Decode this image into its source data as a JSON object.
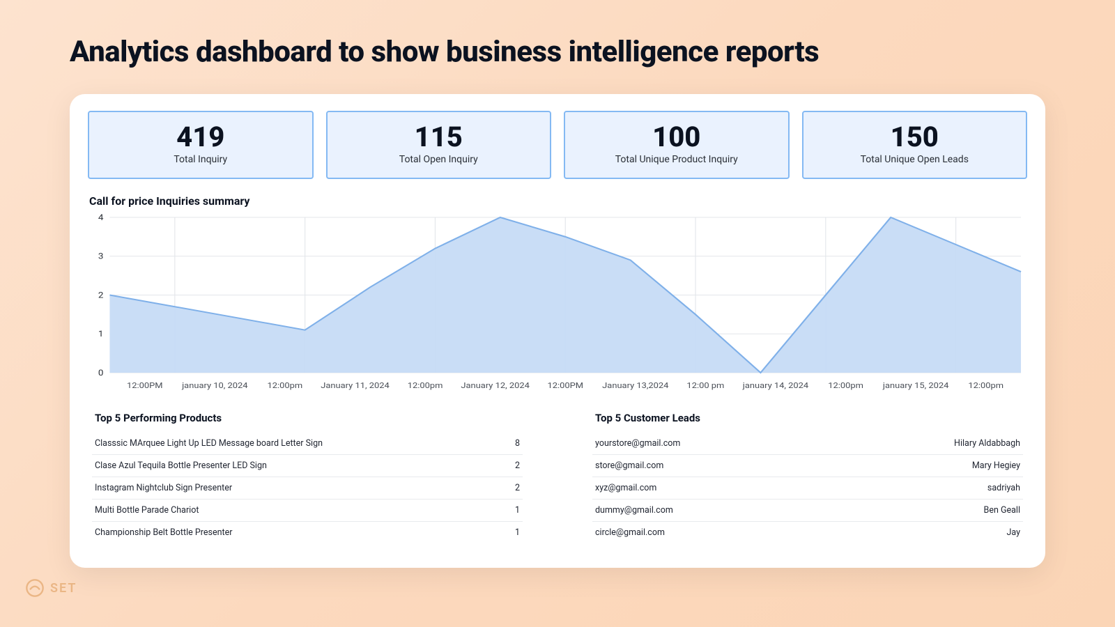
{
  "page_title": "Analytics dashboard to show business intelligence reports",
  "stats": [
    {
      "value": "419",
      "label": "Total Inquiry"
    },
    {
      "value": "115",
      "label": "Total Open Inquiry"
    },
    {
      "value": "100",
      "label": "Total Unique Product Inquiry"
    },
    {
      "value": "150",
      "label": "Total Unique Open Leads"
    }
  ],
  "chart_title": "Call for price Inquiries summary",
  "chart_data": {
    "type": "area",
    "title": "Call for price Inquiries summary",
    "xlabel": "",
    "ylabel": "",
    "ylim": [
      0,
      4
    ],
    "categories": [
      "12:00PM",
      "january 10, 2024",
      "12:00pm",
      "January 11, 2024",
      "12:00pm",
      "January 12, 2024",
      "12:00PM",
      "January 13,2024",
      "12:00 pm",
      "january 14, 2024",
      "12:00pm",
      "january 15, 2024",
      "12:00pm"
    ],
    "values": [
      2.0,
      1.7,
      1.4,
      1.1,
      2.2,
      3.2,
      4.0,
      3.5,
      2.9,
      1.5,
      0.0,
      2.0,
      4.0,
      3.3,
      2.6
    ]
  },
  "products_title": "Top 5 Performing Products",
  "products": [
    {
      "name": "Classsic MArquee Light Up LED Message board Letter Sign",
      "count": "8"
    },
    {
      "name": "Clase Azul Tequila Bottle Presenter LED Sign",
      "count": "2"
    },
    {
      "name": "Instagram Nightclub Sign Presenter",
      "count": "2"
    },
    {
      "name": "Multi Bottle Parade Chariot",
      "count": "1"
    },
    {
      "name": "Championship Belt Bottle Presenter",
      "count": "1"
    }
  ],
  "leads_title": "Top 5 Customer Leads",
  "leads": [
    {
      "email": "yourstore@gmail.com",
      "name": "Hilary Aldabbagh"
    },
    {
      "email": "store@gmail.com",
      "name": "Mary Hegiey"
    },
    {
      "email": "xyz@gmail.com",
      "name": "sadriyah"
    },
    {
      "email": "dummy@gmail.com",
      "name": "Ben Geall"
    },
    {
      "email": "circle@gmail.com",
      "name": "Jay"
    }
  ],
  "watermark": "SET"
}
